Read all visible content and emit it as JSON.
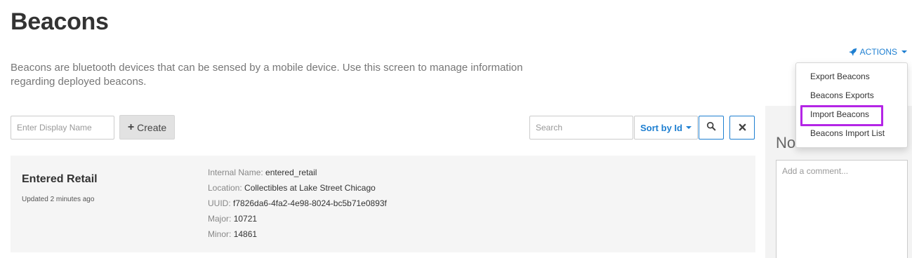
{
  "header": {
    "title": "Beacons",
    "description": "Beacons are bluetooth devices that can be sensed by a mobile device. Use this screen to manage information regarding deployed beacons."
  },
  "actions": {
    "label": "ACTIONS",
    "icon": "rocket-icon",
    "color": "#1e7fd1",
    "menu_items": [
      {
        "label": "Export Beacons"
      },
      {
        "label": "Beacons Exports"
      },
      {
        "label": "Import Beacons",
        "highlighted": true
      },
      {
        "label": "Beacons Import List"
      }
    ],
    "highlight_color": "#b425e6"
  },
  "toolbar": {
    "display_name_placeholder": "Enter Display Name",
    "create_label": "Create",
    "search_placeholder": "Search",
    "sort_label": "Sort by Id",
    "search_icon": "search-icon",
    "clear_icon": "close-icon"
  },
  "beacon": {
    "name": "Entered Retail",
    "updated": "Updated 2 minutes ago",
    "details": [
      {
        "label": "Internal Name:",
        "value": "entered_retail"
      },
      {
        "label": "Location:",
        "value": "Collectibles at Lake Street Chicago"
      },
      {
        "label": "UUID:",
        "value": "f7826da6-4fa2-4e98-8024-bc5b71e0893f"
      },
      {
        "label": "Major:",
        "value": "10721"
      },
      {
        "label": "Minor:",
        "value": "14861"
      }
    ]
  },
  "notes": {
    "title": "Notes",
    "placeholder": "Add a comment..."
  }
}
